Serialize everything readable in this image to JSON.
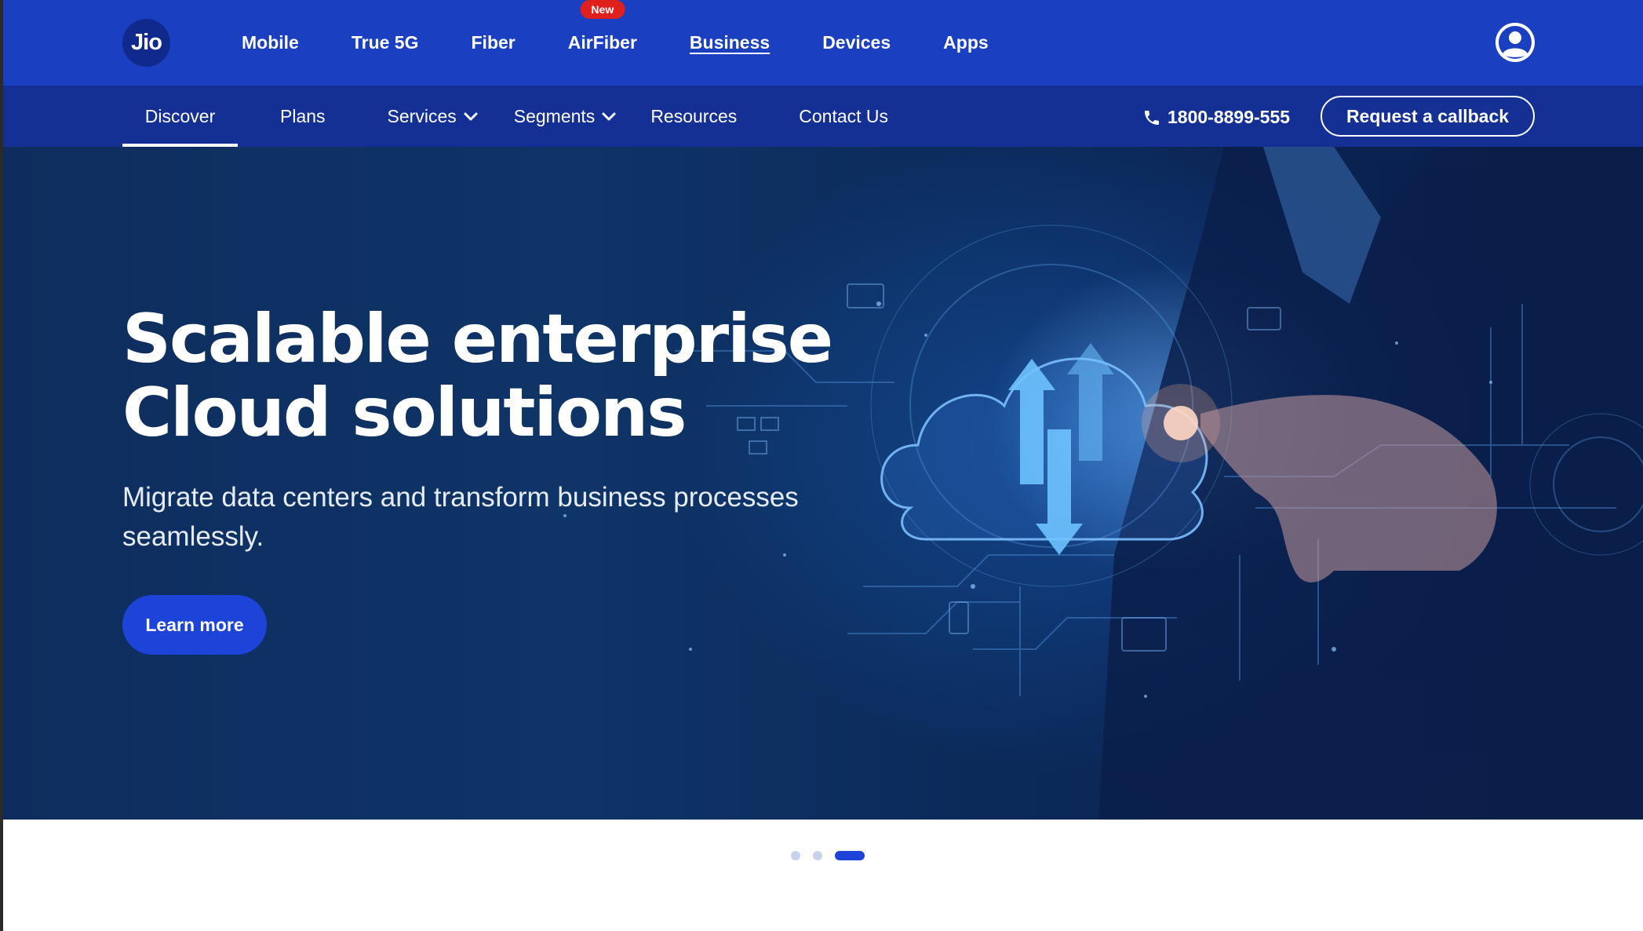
{
  "brand": {
    "logo_text": "Jio"
  },
  "top_nav": {
    "items": [
      {
        "label": "Mobile"
      },
      {
        "label": "True 5G"
      },
      {
        "label": "Fiber"
      },
      {
        "label": "AirFiber",
        "badge": "New"
      },
      {
        "label": "Business",
        "active": true
      },
      {
        "label": "Devices"
      },
      {
        "label": "Apps"
      }
    ],
    "profile_icon": "user-circle-icon"
  },
  "sub_nav": {
    "items": [
      {
        "label": "Discover",
        "active": true
      },
      {
        "label": "Plans"
      },
      {
        "label": "Services",
        "dropdown": true
      },
      {
        "label": "Segments",
        "dropdown": true
      },
      {
        "label": "Resources"
      },
      {
        "label": "Contact Us"
      }
    ],
    "phone": {
      "icon": "phone-icon",
      "number": "1800-8899-555"
    },
    "callback_label": "Request a callback"
  },
  "hero": {
    "headline_line1": "Scalable enterprise",
    "headline_line2": "Cloud solutions",
    "subtext": "Migrate data centers and transform business processes seamlessly.",
    "cta_label": "Learn more"
  },
  "carousel": {
    "slides": 3,
    "active_index": 2
  },
  "colors": {
    "header": "#1a3fc0",
    "subheader": "#143094",
    "accent": "#1c44d8",
    "badge": "#e0201c"
  }
}
